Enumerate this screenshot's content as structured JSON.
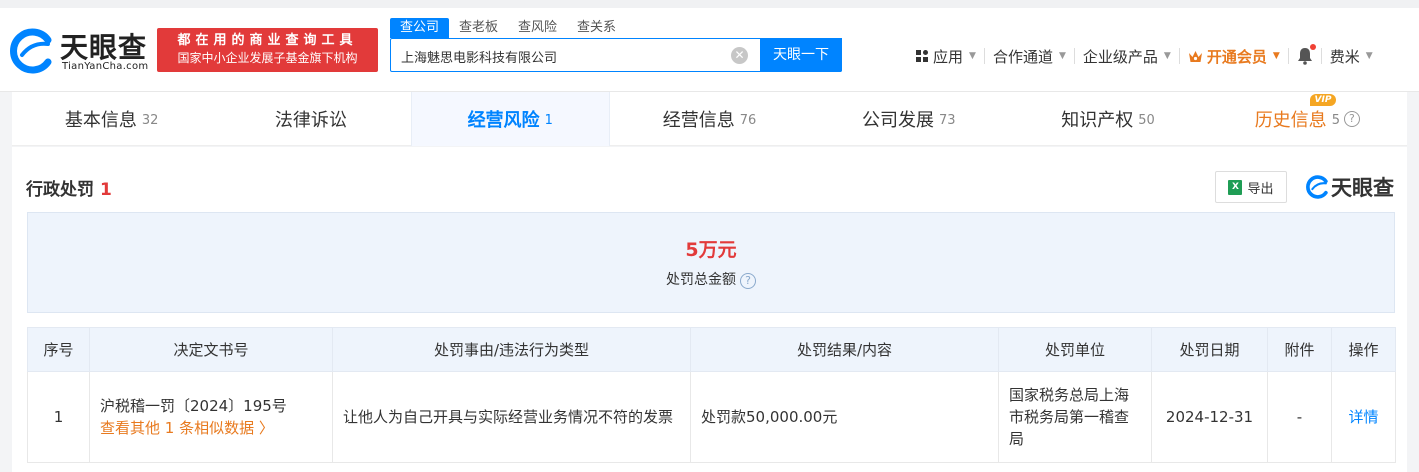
{
  "header": {
    "logo_cn": "天眼查",
    "logo_en": "TianYanCha.com",
    "slogan_line1": "都在用的商业查询工具",
    "slogan_line2": "国家中小企业发展子基金旗下机构"
  },
  "search": {
    "tabs": [
      "查公司",
      "查老板",
      "查风险",
      "查关系"
    ],
    "value": "上海魅思电影科技有限公司",
    "button": "天眼一下"
  },
  "nav": {
    "apps": "应用",
    "partner": "合作通道",
    "enterprise": "企业级产品",
    "vip": "开通会员",
    "user": "费米"
  },
  "tabs": [
    {
      "label": "基本信息",
      "count": "32"
    },
    {
      "label": "法律诉讼",
      "count": ""
    },
    {
      "label": "经营风险",
      "count": "1"
    },
    {
      "label": "经营信息",
      "count": "76"
    },
    {
      "label": "公司发展",
      "count": "73"
    },
    {
      "label": "知识产权",
      "count": "50"
    },
    {
      "label": "历史信息",
      "count": "5"
    }
  ],
  "vip_badge": "VIP",
  "section": {
    "title": "行政处罚",
    "count": "1",
    "export": "导出",
    "brand": "天眼查",
    "amount": "5万元",
    "amount_label": "处罚总金额"
  },
  "table": {
    "headers": [
      "序号",
      "决定文书号",
      "处罚事由/违法行为类型",
      "处罚结果/内容",
      "处罚单位",
      "处罚日期",
      "附件",
      "操作"
    ],
    "rows": [
      {
        "no": "1",
        "doc": "沪税稽一罚〔2024〕195号",
        "similar": "查看其他 1 条相似数据",
        "reason": "让他人为自己开具与实际经营业务情况不符的发票",
        "result": "处罚款50,000.00元",
        "unit": "国家税务总局上海市税务局第一稽查局",
        "date": "2024-12-31",
        "attachment": "-",
        "action": "详情"
      }
    ]
  }
}
